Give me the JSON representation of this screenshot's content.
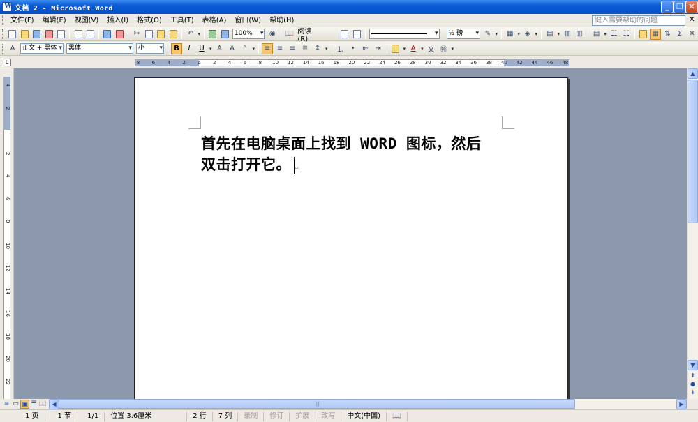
{
  "window": {
    "title": "文档 2 - Microsoft Word"
  },
  "menu": {
    "items": [
      "文件(F)",
      "编辑(E)",
      "视图(V)",
      "插入(I)",
      "格式(O)",
      "工具(T)",
      "表格(A)",
      "窗口(W)",
      "帮助(H)"
    ],
    "help_placeholder": "键入需要帮助的问题"
  },
  "standard_toolbar": {
    "zoom": "100%",
    "read_label": "阅读(R)"
  },
  "drawing_toolbar": {
    "line_weight": "½ 磅"
  },
  "format_toolbar": {
    "style": "正文 + 黑体",
    "font": "黑体",
    "size": "小一",
    "bold": "B",
    "italic": "I",
    "underline": "U"
  },
  "ruler": {
    "h_ticks": [
      "8",
      "6",
      "4",
      "2",
      "",
      "2",
      "4",
      "6",
      "8",
      "10",
      "12",
      "14",
      "16",
      "18",
      "20",
      "22",
      "24",
      "26",
      "28",
      "30",
      "32",
      "34",
      "36",
      "38",
      "40",
      "42",
      "44",
      "46",
      "48"
    ],
    "v_ticks": [
      "4",
      "2",
      "",
      "2",
      "4",
      "6",
      "8",
      "10",
      "12",
      "14",
      "16",
      "18",
      "20",
      "22"
    ]
  },
  "document": {
    "line1": "首先在电脑桌面上找到 WORD 图标，然后",
    "line2": "双击打开它。",
    "pilcrow": "↵"
  },
  "status": {
    "page": "1 页",
    "section": "1 节",
    "page_of": "1/1",
    "position": "位置 3.6厘米",
    "line": "2 行",
    "column": "7 列",
    "rec": "录制",
    "trk": "修订",
    "ext": "扩展",
    "ovr": "改写",
    "language": "中文(中国)"
  }
}
